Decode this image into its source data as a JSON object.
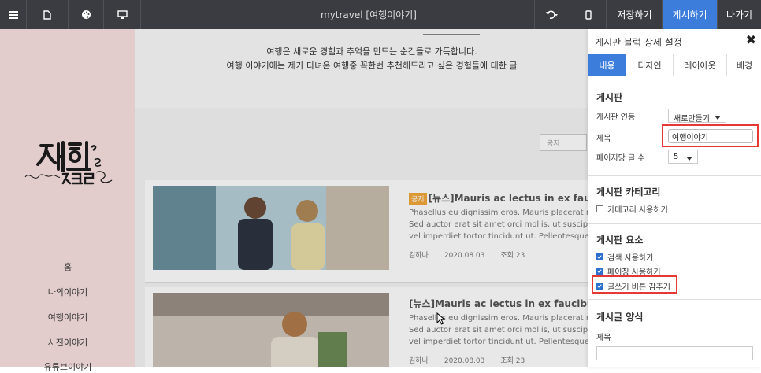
{
  "topbar": {
    "title": "mytravel [여행이야기]",
    "save_label": "저장하기",
    "publish_label": "게시하기",
    "exit_label": "나가기"
  },
  "sidebar": {
    "nav": [
      "홈",
      "나의이야기",
      "여행이야기",
      "사진이야기",
      "유튜브이야기"
    ]
  },
  "main": {
    "intro_line1": "여행은 새로운 경험과 추억을 만드는 순간들로 가득합니다.",
    "intro_line2": "여행 이야기에는 제가 다녀온 여행중 꼭한번 추천해드리고 싶은 경험들에 대한 글",
    "sort_value": "공지",
    "posts": [
      {
        "badge": "공지",
        "title": "[뉴스]Mauris ac lectus in ex faucibus",
        "lines": [
          "Phasellus eu dignissim eros. Mauris placerat ru",
          "Sed auctor erat sit amet orci mollis, ut suscipit",
          "vel imperdiet tortor tincidunt ut. Pellentesque"
        ],
        "author": "김하나",
        "date": "2020.08.03",
        "views": "조회 23"
      },
      {
        "badge": "",
        "title": "[뉴스]Mauris ac lectus in ex faucibus con",
        "lines": [
          "Phasellus eu dignissim eros. Mauris placerat ru",
          "Sed auctor erat sit amet orci mollis, ut suscipit",
          "vel imperdiet tortor tincidunt ut. Pellentesque"
        ],
        "author": "김하나",
        "date": "2020.08.03",
        "views": "조회 23"
      }
    ]
  },
  "panel": {
    "title": "게시판 블럭 상세 설정",
    "tabs": [
      "내용",
      "디자인",
      "레이아웃",
      "배경"
    ],
    "board_section": "게시판",
    "board_link_label": "게시판 연동",
    "board_link_value": "새로만들기",
    "title_label": "제목",
    "title_value": "여행이야기",
    "per_page_label": "페이지당 글 수",
    "per_page_value": "5",
    "category_section": "게시판 카테고리",
    "category_use": "카테고리 사용하기",
    "elements_section": "게시판 요소",
    "opt_search": "검색 사용하기",
    "opt_paging": "페이징 사용하기",
    "opt_hide_write": "글쓰기 버튼 감추기",
    "post_format_section": "게시글 양식",
    "post_title_label": "제목"
  },
  "colors": {
    "topbar": "#3a3c42",
    "accent": "#3c7ddb",
    "sidebar_bg": "#e2cdcc",
    "highlight": "#e53935"
  }
}
